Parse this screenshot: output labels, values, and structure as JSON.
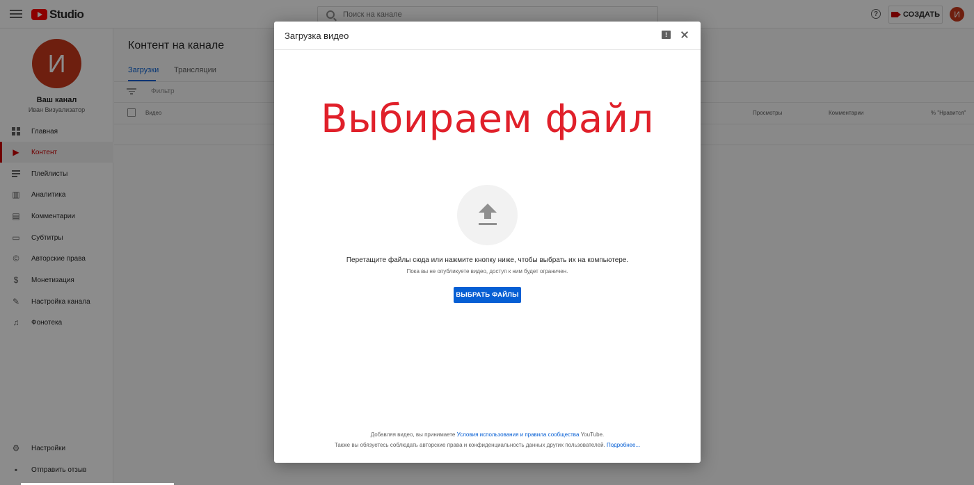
{
  "app": {
    "logo_text": "Studio",
    "search_placeholder": "Поиск на канале",
    "create_label": "СОЗДАТЬ",
    "help_glyph": "?",
    "avatar_letter": "И"
  },
  "sidebar": {
    "channel_letter": "И",
    "channel_title": "Ваш канал",
    "channel_owner": "Иван Визуализатор",
    "items": [
      {
        "label": "Главная",
        "icon": "dashboard-icon"
      },
      {
        "label": "Контент",
        "icon": "content-icon",
        "active": true
      },
      {
        "label": "Плейлисты",
        "icon": "playlist-icon"
      },
      {
        "label": "Аналитика",
        "icon": "analytics-icon"
      },
      {
        "label": "Комментарии",
        "icon": "comments-icon"
      },
      {
        "label": "Субтитры",
        "icon": "subtitles-icon"
      },
      {
        "label": "Авторские права",
        "icon": "copyright-icon"
      },
      {
        "label": "Монетизация",
        "icon": "dollar-icon"
      },
      {
        "label": "Настройка канала",
        "icon": "magic-wand-icon"
      },
      {
        "label": "Фонотека",
        "icon": "audio-library-icon"
      }
    ],
    "bottom_items": [
      {
        "label": "Настройки",
        "icon": "gear-icon"
      },
      {
        "label": "Отправить отзыв",
        "icon": "feedback-icon"
      }
    ]
  },
  "main": {
    "title": "Контент на канале",
    "tabs": [
      {
        "label": "Загрузки",
        "active": true
      },
      {
        "label": "Трансляции",
        "active": false
      }
    ],
    "filter_placeholder": "Фильтр",
    "columns": {
      "video": "Видео",
      "views": "Просмотры",
      "comments": "Комментарии",
      "likes": "% \"Нравится\""
    }
  },
  "dialog": {
    "title": "Загрузка видео",
    "overlay_caption": "Выбираем файл",
    "drop_text": "Перетащите файлы сюда или нажмите кнопку ниже, чтобы выбрать их на компьютере.",
    "drop_subtext": "Пока вы не опубликуете видео, доступ к ним будет ограничен.",
    "select_button": "ВЫБРАТЬ ФАЙЛЫ",
    "terms_prefix": "Добавляя видео, вы принимаете ",
    "terms_link": "Условия использования и правила сообщества",
    "terms_suffix": " YouTube.",
    "terms2_prefix": "Также вы обязуетесь соблюдать авторские права и конфиденциальность данных других пользователей. ",
    "terms2_link": "Подробнее..."
  },
  "colors": {
    "accent": "#065fd4",
    "brand_red": "#ff0000",
    "active_red": "#cc0000",
    "caption_red": "#e0202a"
  }
}
